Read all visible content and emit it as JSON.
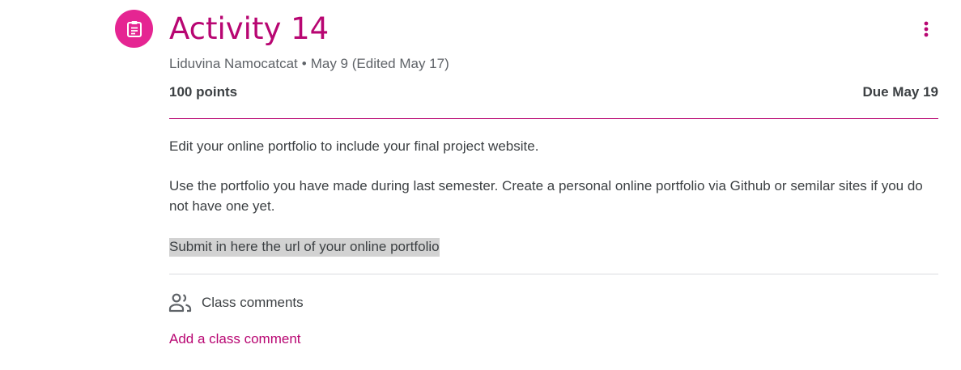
{
  "assignment": {
    "icon": "assignment-clipboard-icon",
    "title": "Activity 14",
    "author": "Liduvina Namocatcat",
    "separator": "•",
    "date": "May 9 (Edited May 17)",
    "points": "100 points",
    "due": "Due May 19",
    "more_icon": "more-vertical-icon"
  },
  "description": {
    "paragraph_1": "Edit your online portfolio to include your final project website.",
    "paragraph_2": "Use the portfolio you have made during last semester. Create a personal online portfolio via Github or semilar sites if you do not have one yet.",
    "paragraph_3": "Submit in here the url of your online portfolio"
  },
  "comments": {
    "icon": "people-icon",
    "label": "Class comments",
    "add_label": "Add a class comment"
  },
  "colors": {
    "accent": "#b80672",
    "icon_background": "#e52592",
    "text": "#3c4043",
    "muted": "#5f6368",
    "highlight": "#d2d2d2",
    "divider": "#dadce0"
  }
}
